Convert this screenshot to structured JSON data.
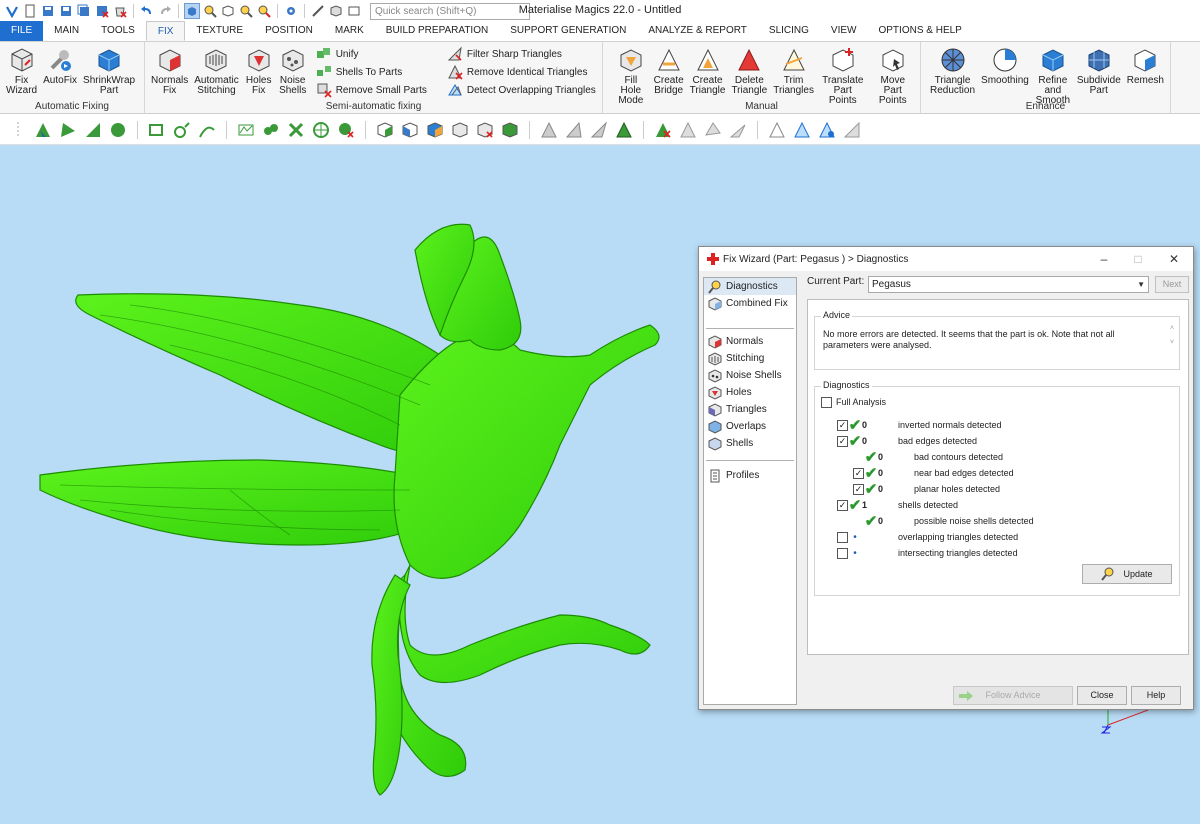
{
  "app": {
    "title": "Materialise Magics 22.0 - Untitled",
    "search_placeholder": "Quick search (Shift+Q)"
  },
  "menu_tabs": [
    "FILE",
    "MAIN",
    "TOOLS",
    "FIX",
    "TEXTURE",
    "POSITION",
    "MARK",
    "BUILD PREPARATION",
    "SUPPORT GENERATION",
    "ANALYZE & REPORT",
    "SLICING",
    "VIEW",
    "OPTIONS & HELP"
  ],
  "active_tab": "FIX",
  "ribbon": {
    "automatic_fixing": {
      "label": "Automatic Fixing",
      "buttons": [
        {
          "l1": "Fix",
          "l2": "Wizard"
        },
        {
          "l1": "AutoFix",
          "l2": ""
        },
        {
          "l1": "ShrinkWrap",
          "l2": "Part"
        }
      ]
    },
    "semi_automatic": {
      "label": "Semi-automatic fixing",
      "buttons": [
        {
          "l1": "Normals",
          "l2": "Fix"
        },
        {
          "l1": "Automatic",
          "l2": "Stitching"
        },
        {
          "l1": "Holes",
          "l2": "Fix"
        },
        {
          "l1": "Noise",
          "l2": "Shells"
        }
      ],
      "small": [
        "Unify",
        "Shells To Parts",
        "Remove Small Parts"
      ],
      "small2": [
        "Filter Sharp Triangles",
        "Remove Identical Triangles",
        "Detect Overlapping Triangles"
      ]
    },
    "manual": {
      "label": "Manual",
      "buttons": [
        {
          "l1": "Fill Hole",
          "l2": "Mode"
        },
        {
          "l1": "Create",
          "l2": "Bridge"
        },
        {
          "l1": "Create",
          "l2": "Triangle"
        },
        {
          "l1": "Delete",
          "l2": "Triangle"
        },
        {
          "l1": "Trim",
          "l2": "Triangles"
        },
        {
          "l1": "Translate",
          "l2": "Part Points"
        },
        {
          "l1": "Move Part",
          "l2": "Points"
        }
      ]
    },
    "enhance": {
      "label": "Enhance",
      "buttons": [
        {
          "l1": "Triangle",
          "l2": "Reduction"
        },
        {
          "l1": "Smoothing",
          "l2": ""
        },
        {
          "l1": "Refine and",
          "l2": "Smooth"
        },
        {
          "l1": "Subdivide",
          "l2": "Part"
        },
        {
          "l1": "Remesh",
          "l2": ""
        }
      ]
    }
  },
  "dialog": {
    "title": "Fix Wizard (Part: Pegasus ) > Diagnostics",
    "nav_top": [
      "Diagnostics",
      "Combined Fix"
    ],
    "nav_mid": [
      "Normals",
      "Stitching",
      "Noise Shells",
      "Holes",
      "Triangles",
      "Overlaps",
      "Shells"
    ],
    "nav_bottom": [
      "Profiles"
    ],
    "current_part_label": "Current Part:",
    "current_part": "Pegasus",
    "next_label": "Next",
    "advice_legend": "Advice",
    "advice_text": "No more errors are detected. It seems that the part is ok. Note that not all parameters were analysed.",
    "diagnostics_legend": "Diagnostics",
    "full_analysis": "Full Analysis",
    "rows": [
      {
        "checked": true,
        "status": "ok",
        "count": "0",
        "text": "inverted normals detected",
        "indent": 0
      },
      {
        "checked": true,
        "status": "ok",
        "count": "0",
        "text": "bad edges detected",
        "indent": 0
      },
      {
        "checked": null,
        "status": "ok",
        "count": "0",
        "text": "bad contours detected",
        "indent": 1
      },
      {
        "checked": true,
        "status": "ok",
        "count": "0",
        "text": "near bad edges detected",
        "indent": 1
      },
      {
        "checked": true,
        "status": "ok",
        "count": "0",
        "text": "planar holes detected",
        "indent": 1
      },
      {
        "checked": true,
        "status": "ok",
        "count": "1",
        "text": "shells detected",
        "indent": 0
      },
      {
        "checked": null,
        "status": "ok",
        "count": "0",
        "text": "possible noise shells detected",
        "indent": 1
      },
      {
        "checked": false,
        "status": "dot",
        "count": "",
        "text": "overlapping triangles detected",
        "indent": 0
      },
      {
        "checked": false,
        "status": "dot",
        "count": "",
        "text": "intersecting triangles detected",
        "indent": 0
      }
    ],
    "update_label": "Update",
    "follow_label": "Follow Advice",
    "close_label": "Close",
    "help_label": "Help"
  },
  "colors": {
    "viewport_bg": "#b8dcf6",
    "model": "#44e010",
    "accent": "#1e6fd0"
  }
}
